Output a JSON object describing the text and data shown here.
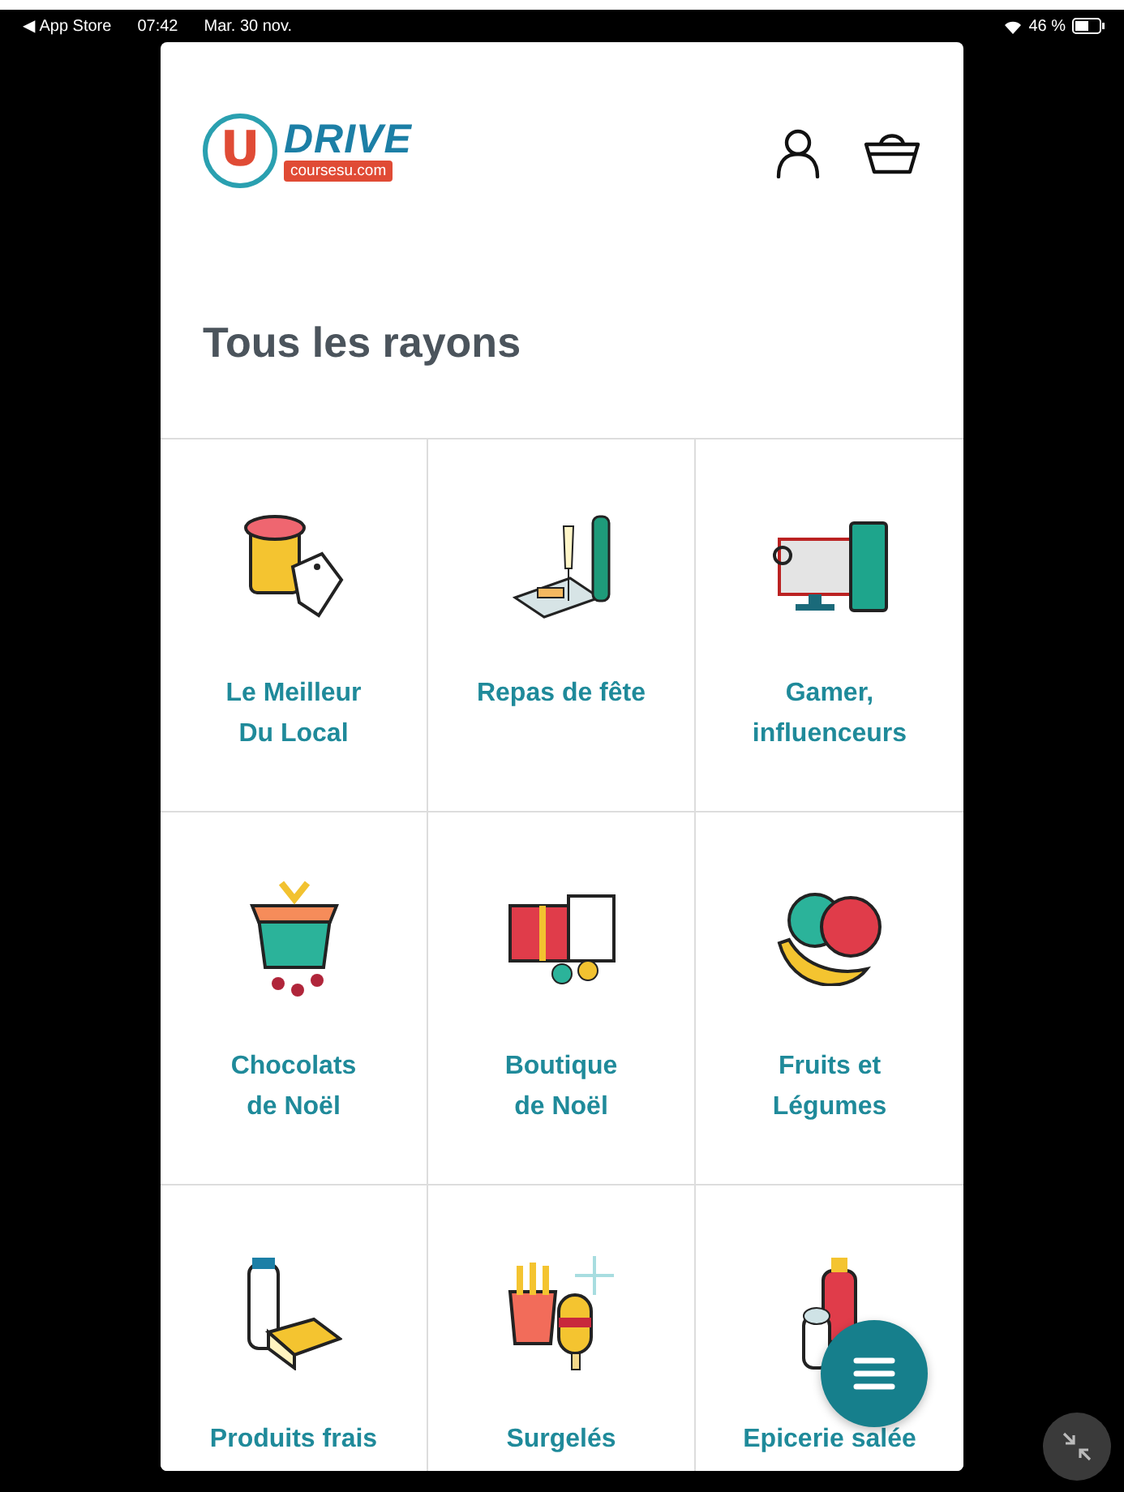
{
  "status_bar": {
    "back": "◀ App Store",
    "time": "07:42",
    "date": "Mar. 30 nov.",
    "battery": "46 %"
  },
  "logo": {
    "letter": "U",
    "word": "DRIVE",
    "domain": "coursesu.com"
  },
  "title": "Tous les rayons",
  "categories": [
    {
      "label": "Le Meilleur\nDu Local"
    },
    {
      "label": "Repas de fête"
    },
    {
      "label": "Gamer,\ninfluenceurs"
    },
    {
      "label": "Chocolats\nde Noël"
    },
    {
      "label": "Boutique\nde Noël"
    },
    {
      "label": "Fruits et\nLégumes"
    },
    {
      "label": "Produits frais"
    },
    {
      "label": "Surgelés"
    },
    {
      "label": "Epicerie salée"
    }
  ]
}
